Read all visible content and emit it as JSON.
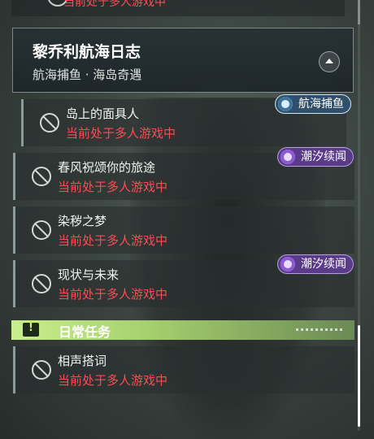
{
  "top_partial": {
    "status": "当前处于多人游戏中"
  },
  "chapter": {
    "title": "黎乔利航海日志",
    "subtitle": "航海捕鱼 · 海岛奇遇"
  },
  "quests": [
    {
      "name": "岛上的面具人",
      "status": "当前处于多人游戏中",
      "tag": "航海捕鱼",
      "tag_color": "blue",
      "icon": "locked-icon"
    },
    {
      "name": "春风祝颂你的旅途",
      "status": "当前处于多人游戏中",
      "tag": "潮汐续闻",
      "tag_color": "purple",
      "icon": "locked-icon"
    },
    {
      "name": "染秽之梦",
      "status": "当前处于多人游戏中",
      "tag": "",
      "icon": "locked-icon"
    },
    {
      "name": "现状与未来",
      "status": "当前处于多人游戏中",
      "tag": "潮汐续闻",
      "tag_color": "purple",
      "icon": "locked-icon"
    }
  ],
  "daily": {
    "label": "日常任务",
    "quests": [
      {
        "name": "相声搭词",
        "status": "当前处于多人游戏中",
        "icon": "locked-icon"
      }
    ]
  },
  "colors": {
    "warning_red": "#ff4a55",
    "daily_green": "#c9ee8c",
    "tag_purple": "#5a3b8a",
    "tag_blue": "#2f4f6a"
  }
}
